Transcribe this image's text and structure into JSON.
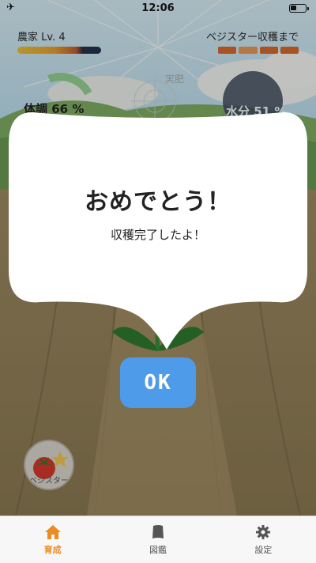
{
  "status_bar": {
    "time": "12:06"
  },
  "hud": {
    "farmer_level": "農家 Lv. 4",
    "harvest_label": "ベジスター収穫まで",
    "health_label": "体調 66 %",
    "water_label": "水分 51 %",
    "fertilizer_label": "実肥",
    "health_percent": 66,
    "water_percent": 51
  },
  "dialog": {
    "title": "おめでとう！",
    "message": "収穫完了したよ！",
    "ok_label": "OK"
  },
  "vegetable": {
    "label": "ベジスター"
  },
  "tabs": [
    {
      "label": "育成",
      "icon": "home-icon",
      "active": true
    },
    {
      "label": "図鑑",
      "icon": "book-icon",
      "active": false
    },
    {
      "label": "設定",
      "icon": "gear-icon",
      "active": false
    }
  ],
  "colors": {
    "accent": "#ec8a24",
    "ok_button": "#4d9be9"
  }
}
